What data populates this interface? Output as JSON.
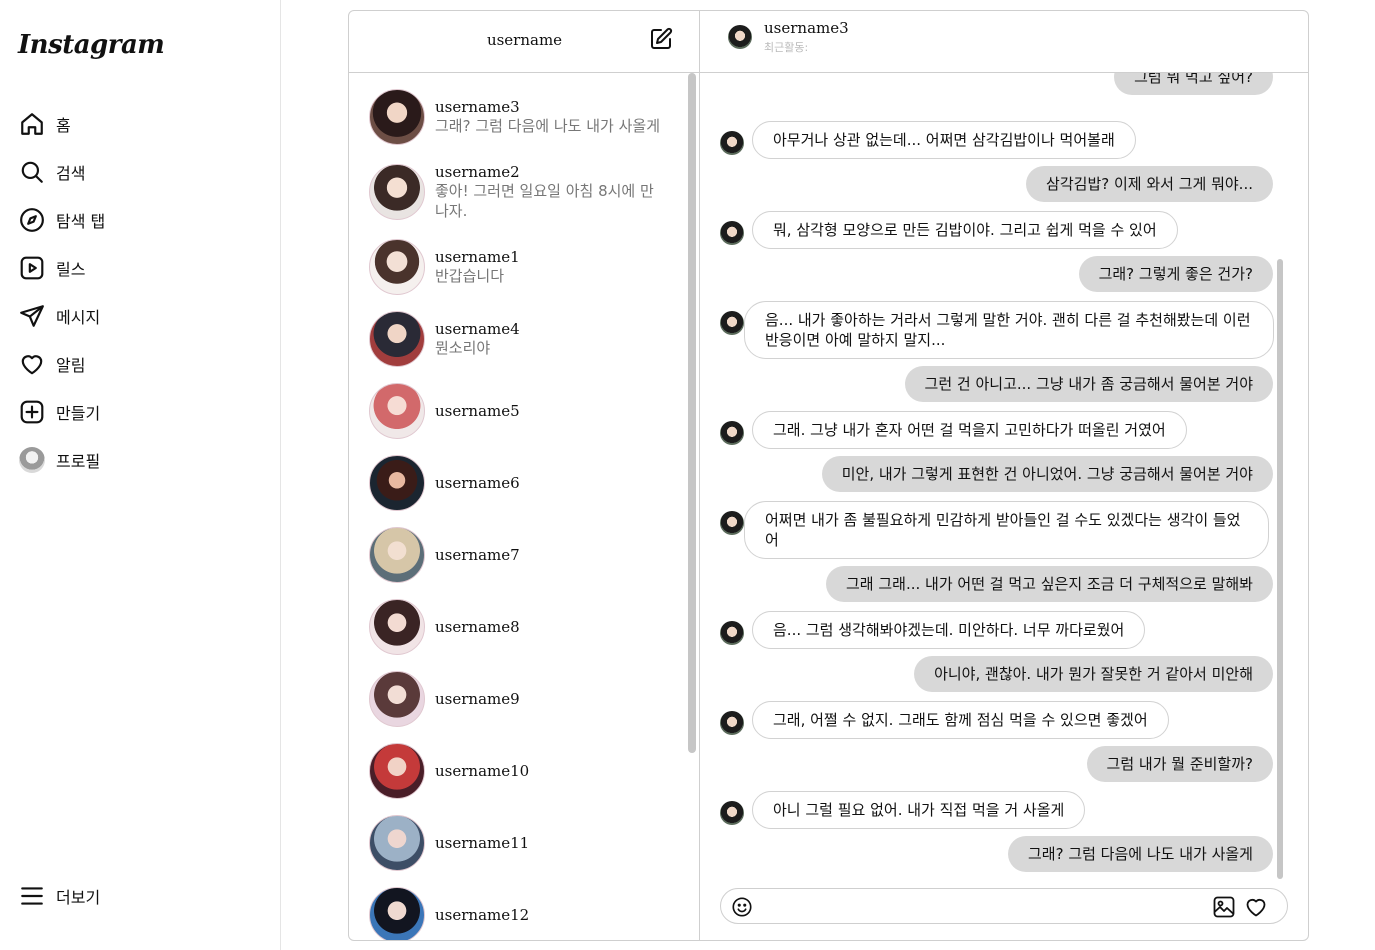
{
  "sidebar": {
    "logo": "Instagram",
    "items": [
      {
        "label": "홈",
        "icon": "home-icon"
      },
      {
        "label": "검색",
        "icon": "search-icon"
      },
      {
        "label": "탐색 탭",
        "icon": "compass-icon"
      },
      {
        "label": "릴스",
        "icon": "reels-icon"
      },
      {
        "label": "메시지",
        "icon": "send-icon"
      },
      {
        "label": "알림",
        "icon": "heart-icon"
      },
      {
        "label": "만들기",
        "icon": "plus-square-icon"
      },
      {
        "label": "프로필",
        "icon": "profile-avatar"
      }
    ],
    "more": {
      "label": "더보기",
      "icon": "hamburger-icon"
    }
  },
  "list_header": {
    "title": "username",
    "compose_icon": "edit-icon"
  },
  "chat_header": {
    "name": "username3",
    "status": "최근활동:"
  },
  "conversations": [
    {
      "name": "username3",
      "preview": "그래? 그럼 다음에 나도 내가 사올게"
    },
    {
      "name": "username2",
      "preview": "좋아! 그러면 일요일 아침 8시에 만나자."
    },
    {
      "name": "username1",
      "preview": "반갑습니다"
    },
    {
      "name": "username4",
      "preview": "뭔소리야"
    },
    {
      "name": "username5",
      "preview": ""
    },
    {
      "name": "username6",
      "preview": ""
    },
    {
      "name": "username7",
      "preview": ""
    },
    {
      "name": "username8",
      "preview": ""
    },
    {
      "name": "username9",
      "preview": ""
    },
    {
      "name": "username10",
      "preview": ""
    },
    {
      "name": "username11",
      "preview": ""
    },
    {
      "name": "username12",
      "preview": ""
    }
  ],
  "messages": [
    {
      "from": "me",
      "text": "그럼 뭐 먹고 싶어?"
    },
    {
      "from": "them",
      "text": "아무거나 상관 없는데... 어쩌면 삼각김밥이나 먹어볼래"
    },
    {
      "from": "me",
      "text": "삼각김밥? 이제 와서 그게 뭐야..."
    },
    {
      "from": "them",
      "text": "뭐, 삼각형 모양으로 만든 김밥이야. 그리고 쉽게 먹을 수 있어"
    },
    {
      "from": "me",
      "text": "그래? 그렇게 좋은 건가?"
    },
    {
      "from": "them",
      "text": "음... 내가 좋아하는 거라서 그렇게 말한 거야. 괜히 다른 걸 추천해봤는데 이런 반응이면 아예 말하지 말지..."
    },
    {
      "from": "me",
      "text": "그런 건 아니고... 그냥 내가 좀 궁금해서 물어본 거야"
    },
    {
      "from": "them",
      "text": "그래. 그냥 내가 혼자 어떤 걸 먹을지 고민하다가 떠올린 거였어"
    },
    {
      "from": "me",
      "text": "미안, 내가 그렇게 표현한 건 아니었어. 그냥 궁금해서 물어본 거야"
    },
    {
      "from": "them",
      "text": "어쩌면 내가 좀 불필요하게 민감하게 받아들인 걸 수도 있겠다는 생각이 들었어"
    },
    {
      "from": "me",
      "text": "그래 그래... 내가 어떤 걸 먹고 싶은지 조금 더 구체적으로 말해봐"
    },
    {
      "from": "them",
      "text": "음... 그럼 생각해봐야겠는데. 미안하다. 너무 까다로웠어"
    },
    {
      "from": "me",
      "text": "아니야, 괜찮아. 내가 뭔가 잘못한 거 같아서 미안해"
    },
    {
      "from": "them",
      "text": "그래, 어쩔 수 없지. 그래도 함께 점심 먹을 수 있으면 좋겠어"
    },
    {
      "from": "me",
      "text": "그럼 내가 뭘 준비할까?"
    },
    {
      "from": "them",
      "text": "아니 그럴 필요 없어. 내가 직접 먹을 거 사올게"
    },
    {
      "from": "me",
      "text": "그래? 그럼 다음에 나도 내가 사올게"
    }
  ],
  "composer": {
    "placeholder": "",
    "emoji_icon": "smile-icon",
    "image_icon": "image-icon",
    "like_icon": "heart-icon"
  }
}
